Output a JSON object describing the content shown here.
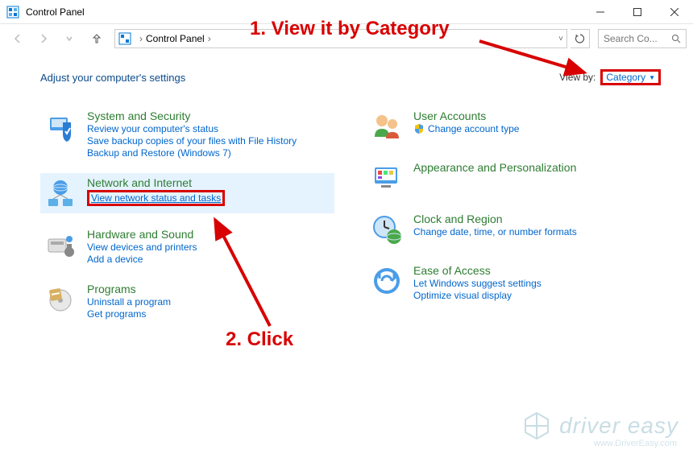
{
  "window": {
    "title": "Control Panel"
  },
  "nav": {
    "breadcrumb": "Control Panel",
    "search_placeholder": "Search Co..."
  },
  "heading": "Adjust your computer's settings",
  "viewby": {
    "label": "View by:",
    "value": "Category"
  },
  "left_col": [
    {
      "title": "System and Security",
      "links": [
        "Review your computer's status",
        "Save backup copies of your files with File History",
        "Backup and Restore (Windows 7)"
      ]
    },
    {
      "title": "Network and Internet",
      "links": [
        "View network status and tasks"
      ],
      "highlighted": true,
      "boxed_link_index": 0
    },
    {
      "title": "Hardware and Sound",
      "links": [
        "View devices and printers",
        "Add a device"
      ]
    },
    {
      "title": "Programs",
      "links": [
        "Uninstall a program",
        "Get programs"
      ]
    }
  ],
  "right_col": [
    {
      "title": "User Accounts",
      "links": [
        "Change account type"
      ],
      "shielded": [
        0
      ]
    },
    {
      "title": "Appearance and Personalization",
      "links": []
    },
    {
      "title": "Clock and Region",
      "links": [
        "Change date, time, or number formats"
      ]
    },
    {
      "title": "Ease of Access",
      "links": [
        "Let Windows suggest settings",
        "Optimize visual display"
      ]
    }
  ],
  "annotations": {
    "step1": "1. View it by Category",
    "step2": "2. Click"
  },
  "watermark": {
    "brand": "driver easy",
    "url": "www.DriverEasy.com"
  }
}
